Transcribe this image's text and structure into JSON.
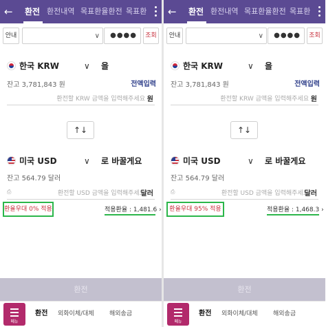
{
  "panes": [
    {
      "topbar": {
        "tabs": [
          "환전",
          "환전내역",
          "목표환율환전",
          "목표환"
        ]
      },
      "account": {
        "guide_label": "안내",
        "password_mask": "●●●●",
        "inquiry_label": "조회"
      },
      "from": {
        "currency": "한국 KRW",
        "particle": "을",
        "balance": "잔고 3,781,843 원",
        "full_input": "전액입력",
        "placeholder": "환전할 KRW 금액을 입력해주세요",
        "unit": "원"
      },
      "swap_label": "↑↓",
      "to": {
        "currency": "미국 USD",
        "particle": "로 바꿀게요",
        "balance": "잔고 564.79 달러",
        "placeholder": "환전할 USD 금액을 입력해주세요",
        "unit": "달러"
      },
      "preferential": "환율우대 0% 적용",
      "applied_rate": "적용환율 : 1,481.6 ›",
      "exchange_button": "환전",
      "bottom_nav": {
        "menu_label": "메뉴",
        "items": [
          "환전",
          "외화이체/대체",
          "해외송금"
        ]
      }
    },
    {
      "topbar": {
        "tabs": [
          "환전",
          "환전내역",
          "목표환율환전",
          "목표환"
        ]
      },
      "account": {
        "guide_label": "안내",
        "password_mask": "●●●●",
        "inquiry_label": "조회"
      },
      "from": {
        "currency": "한국 KRW",
        "particle": "을",
        "balance": "잔고 3,781,843 원",
        "full_input": "전액입력",
        "placeholder": "환전할 KRW 금액을 입력해주세요",
        "unit": "원"
      },
      "swap_label": "↑↓",
      "to": {
        "currency": "미국 USD",
        "particle": "로 바꿀게요",
        "balance": "잔고 564.79 달러",
        "placeholder": "환전할 USD 금액을 입력해주세요",
        "unit": "달러"
      },
      "preferential": "환율우대 95% 적용",
      "applied_rate": "적용환율 : 1,468.3 ›",
      "exchange_button": "환전",
      "bottom_nav": {
        "menu_label": "메뉴",
        "items": [
          "환전",
          "외화이체/대체",
          "해외송금"
        ]
      }
    }
  ],
  "colors": {
    "header": "#5b4a93",
    "menu": "#b22a6b",
    "highlight": "#2bb64a",
    "accent_red": "#c8323f",
    "link_blue": "#2f3f8a"
  },
  "icons": [
    "back-arrow-icon",
    "kebab-menu-icon",
    "chevron-down-icon",
    "calculator-icon",
    "swap-icon",
    "hamburger-icon"
  ]
}
